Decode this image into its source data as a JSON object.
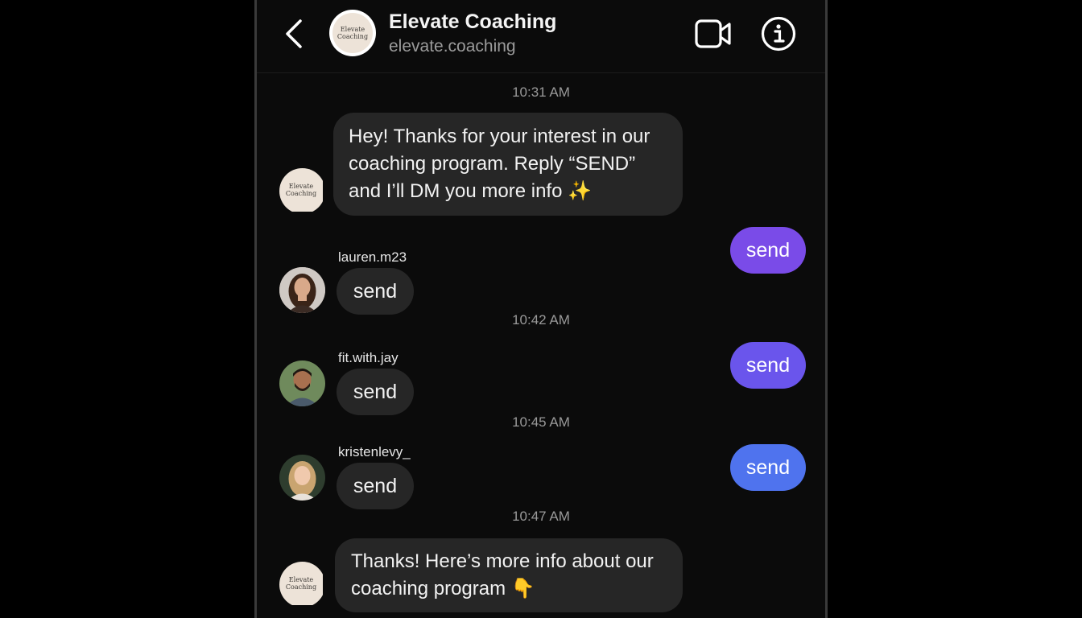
{
  "header": {
    "title": "Elevate Coaching",
    "subtitle": "elevate.coaching",
    "logo_text": "Elevate Coaching",
    "icons": [
      "chevron-left-icon",
      "video-camera-icon",
      "info-icon"
    ]
  },
  "messages": {
    "ts1": "10:31 AM",
    "intro": "Hey! Thanks for your interest in our coaching program. Reply “SEND” and I’ll DM you more info ✨",
    "out1": "send",
    "user1_name": "lauren.m23",
    "user1_msg": "send",
    "ts2": "10:42 AM",
    "out2": "send",
    "user2_name": "fit.with.jay",
    "user2_msg": "send",
    "ts3": "10:45 AM",
    "out3": "send",
    "user3_name": "kristenlevy_",
    "user3_msg": "send",
    "ts4": "10:47 AM",
    "final": "Thanks! Here’s more info about our coaching program 👇"
  },
  "colors": {
    "out1": "#7a4be8",
    "out2": "#6a55ec",
    "out3": "#4f73ee"
  }
}
